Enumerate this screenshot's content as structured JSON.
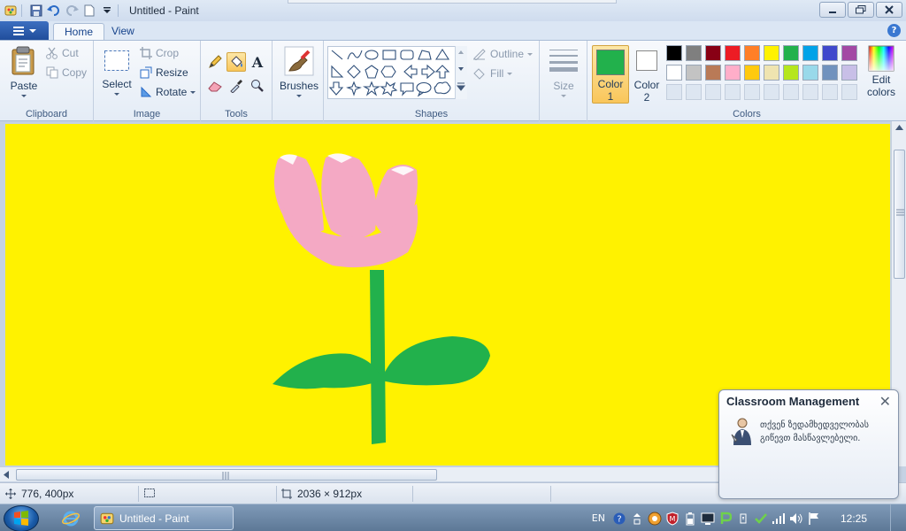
{
  "window": {
    "title": "Untitled - Paint"
  },
  "tabs": [
    {
      "label": "Home"
    },
    {
      "label": "View"
    }
  ],
  "ribbon": {
    "clipboard": {
      "paste": "Paste",
      "cut": "Cut",
      "copy": "Copy",
      "group": "Clipboard"
    },
    "image": {
      "select": "Select",
      "crop": "Crop",
      "resize": "Resize",
      "rotate": "Rotate",
      "group": "Image"
    },
    "tools": {
      "group": "Tools",
      "text_tool": "A"
    },
    "brushes": {
      "label": "Brushes"
    },
    "shapes": {
      "outline": "Outline",
      "fill": "Fill",
      "group": "Shapes"
    },
    "size": {
      "label": "Size"
    },
    "colors": {
      "color1_label": "Color",
      "color1_num": "1",
      "color2_label": "Color",
      "color2_num": "2",
      "edit_label": "Edit",
      "edit_label2": "colors",
      "group": "Colors",
      "color1_value": "#22b14c",
      "color2_value": "#ffffff",
      "palette_row1": [
        "#000000",
        "#7f7f7f",
        "#880015",
        "#ed1c24",
        "#ff7f27",
        "#fff200",
        "#22b14c",
        "#00a2e8",
        "#3f48cc",
        "#a349a4"
      ],
      "palette_row2": [
        "#ffffff",
        "#c3c3c3",
        "#b97a57",
        "#ffaec9",
        "#ffc90e",
        "#efe4b0",
        "#b5e61d",
        "#99d9ea",
        "#7092be",
        "#c8bfe7"
      ]
    }
  },
  "canvas": {
    "background": "#fff200",
    "petal_color": "#f4a9c4",
    "stem_color": "#22b14c"
  },
  "status": {
    "cursor_pos": "776, 400px",
    "canvas_size": "2036 × 912px"
  },
  "notification": {
    "title": "Classroom Management",
    "message": "თქვენ ზედამხედველობას გიწევთ მასწავლებელი."
  },
  "taskbar": {
    "task_label": "Untitled - Paint",
    "lang": "EN",
    "clock": "12:25"
  }
}
